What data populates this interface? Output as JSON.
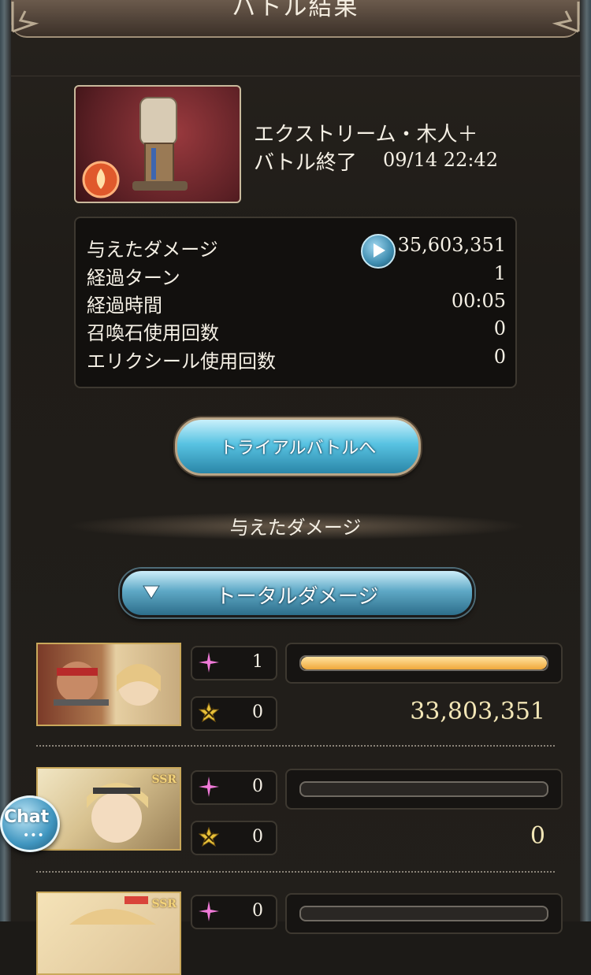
{
  "header": {
    "title": "バトル結果"
  },
  "quest": {
    "name": "エクストリーム・木人＋",
    "status": "バトル終了",
    "date": "09/14 22:42"
  },
  "stats": [
    {
      "label": "与えたダメージ",
      "value": "35,603,351"
    },
    {
      "label": "経過ターン",
      "value": "1"
    },
    {
      "label": "経過時間",
      "value": "00:05"
    },
    {
      "label": "召喚石使用回数",
      "value": "0"
    },
    {
      "label": "エリクシール使用回数",
      "value": "0"
    }
  ],
  "trial_button": {
    "label": "トライアルバトルへ"
  },
  "section": {
    "title": "与えたダメージ"
  },
  "damage_filter": {
    "label": "トータルダメージ"
  },
  "rows": [
    {
      "rarity": "",
      "charge": "1",
      "skill": "0",
      "damage": "33,803,351",
      "bar_fraction": 1.0
    },
    {
      "rarity": "SSR",
      "charge": "0",
      "skill": "0",
      "damage": "0",
      "bar_fraction": 0.0
    },
    {
      "rarity": "SSR",
      "charge": "0",
      "skill": "",
      "damage": "",
      "bar_fraction": 0.0
    }
  ],
  "chat": {
    "label": "Chat",
    "dots": "•••"
  },
  "colors": {
    "bar_fill": "#f0a83a",
    "button_blue": "#58c3e2",
    "charge_icon": "#f07ad8",
    "skill_icon": "#e8c23a"
  }
}
